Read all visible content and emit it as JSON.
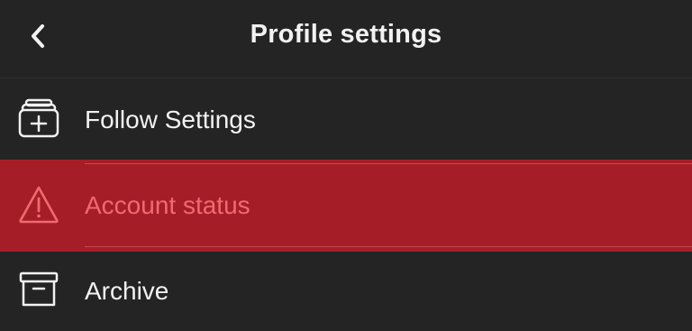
{
  "header": {
    "back_icon": "chevron-left-icon",
    "title": "Profile settings"
  },
  "menu": {
    "items": [
      {
        "label": "Follow Settings",
        "icon": "stack-plus-icon"
      },
      {
        "label": "Account status",
        "icon": "warning-triangle-icon",
        "highlighted": true,
        "highlight_color": "#a51e27",
        "text_color": "#ee6b70"
      },
      {
        "label": "Archive",
        "icon": "archive-box-icon"
      }
    ]
  },
  "colors": {
    "background": "#242424",
    "text": "#f2f2f2",
    "highlight": "#a51e27"
  }
}
